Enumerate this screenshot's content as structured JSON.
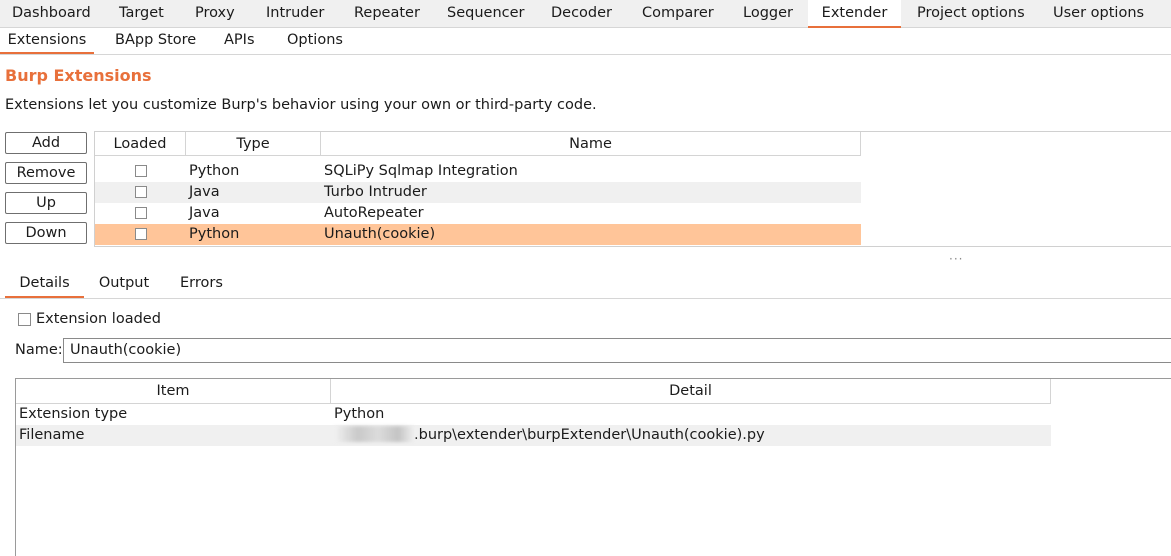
{
  "top_tabs": [
    "Dashboard",
    "Target",
    "Proxy",
    "Intruder",
    "Repeater",
    "Sequencer",
    "Decoder",
    "Comparer",
    "Logger",
    "Extender",
    "Project options",
    "User options"
  ],
  "active_top_tab": "Extender",
  "sub_tabs": [
    "Extensions",
    "BApp Store",
    "APIs",
    "Options"
  ],
  "active_sub_tab": "Extensions",
  "section": {
    "title": "Burp Extensions",
    "description": "Extensions let you customize Burp's behavior using your own or third-party code."
  },
  "buttons": {
    "add": "Add",
    "remove": "Remove",
    "up": "Up",
    "down": "Down"
  },
  "extensions_table": {
    "columns": [
      "Loaded",
      "Type",
      "Name"
    ],
    "rows": [
      {
        "loaded": false,
        "type": "Python",
        "name": "SQLiPy Sqlmap Integration"
      },
      {
        "loaded": false,
        "type": "Java",
        "name": "Turbo Intruder"
      },
      {
        "loaded": false,
        "type": "Java",
        "name": "AutoRepeater"
      },
      {
        "loaded": false,
        "type": "Python",
        "name": "Unauth(cookie)",
        "selected": true
      }
    ]
  },
  "detail_tabs": [
    "Details",
    "Output",
    "Errors"
  ],
  "active_detail_tab": "Details",
  "details": {
    "extension_loaded_label": "Extension loaded",
    "extension_loaded": false,
    "name_label": "Name:",
    "name_value": "Unauth(cookie)",
    "table_columns": [
      "Item",
      "Detail"
    ],
    "rows": [
      {
        "item": "Extension type",
        "detail": "Python"
      },
      {
        "item": "Filename",
        "detail": ".burp\\extender\\burpExtender\\Unauth(cookie).py"
      }
    ]
  },
  "colors": {
    "accent": "#e8703b",
    "selected_row": "#ffc599",
    "alt_row": "#f0f0f0"
  }
}
